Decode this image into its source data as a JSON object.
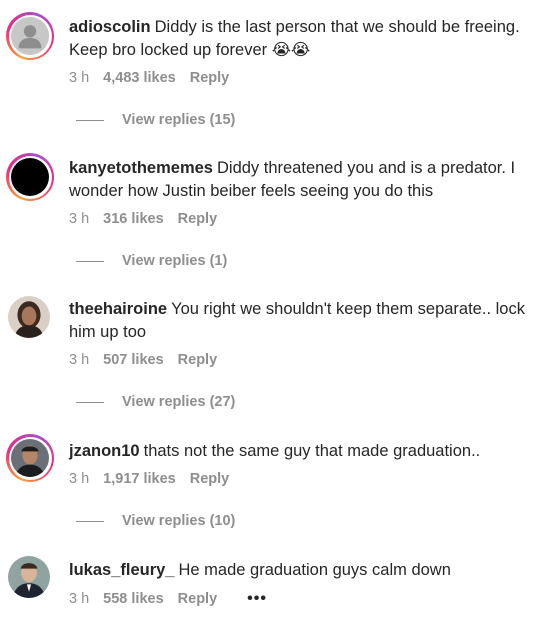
{
  "comments": [
    {
      "username": "adioscolin",
      "text": "Diddy is the last person that we should be freeing. Keep bro locked up forever 😭😭",
      "time": "3 h",
      "likes": "4,483 likes",
      "reply": "Reply",
      "view_replies": "View replies (15)",
      "avatar_icon": "default-person-icon"
    },
    {
      "username": "kanyetothememes",
      "text": "Diddy threatened you and is a predator. I wonder how Justin beiber feels seeing you do this",
      "time": "3 h",
      "likes": "316 likes",
      "reply": "Reply",
      "view_replies": "View replies (1)",
      "avatar_icon": "black-circle-avatar"
    },
    {
      "username": "theehairoine",
      "text": "You right we shouldn't keep them separate.. lock him up too",
      "time": "3 h",
      "likes": "507 likes",
      "reply": "Reply",
      "view_replies": "View replies (27)",
      "avatar_icon": "photo-avatar"
    },
    {
      "username": "jzanon10",
      "text": "thats not the same guy that made graduation..",
      "time": "3 h",
      "likes": "1,917 likes",
      "reply": "Reply",
      "view_replies": "View replies (10)",
      "avatar_icon": "photo-avatar"
    },
    {
      "username": "lukas_fleury_",
      "text": "He made graduation guys calm down",
      "time": "3 h",
      "likes": "558 likes",
      "reply": "Reply",
      "more": "•••",
      "avatar_icon": "photo-avatar"
    }
  ],
  "colors": {
    "text": "#262626",
    "secondary": "#8e8e8e",
    "story_ring": "#ee2a7b"
  }
}
